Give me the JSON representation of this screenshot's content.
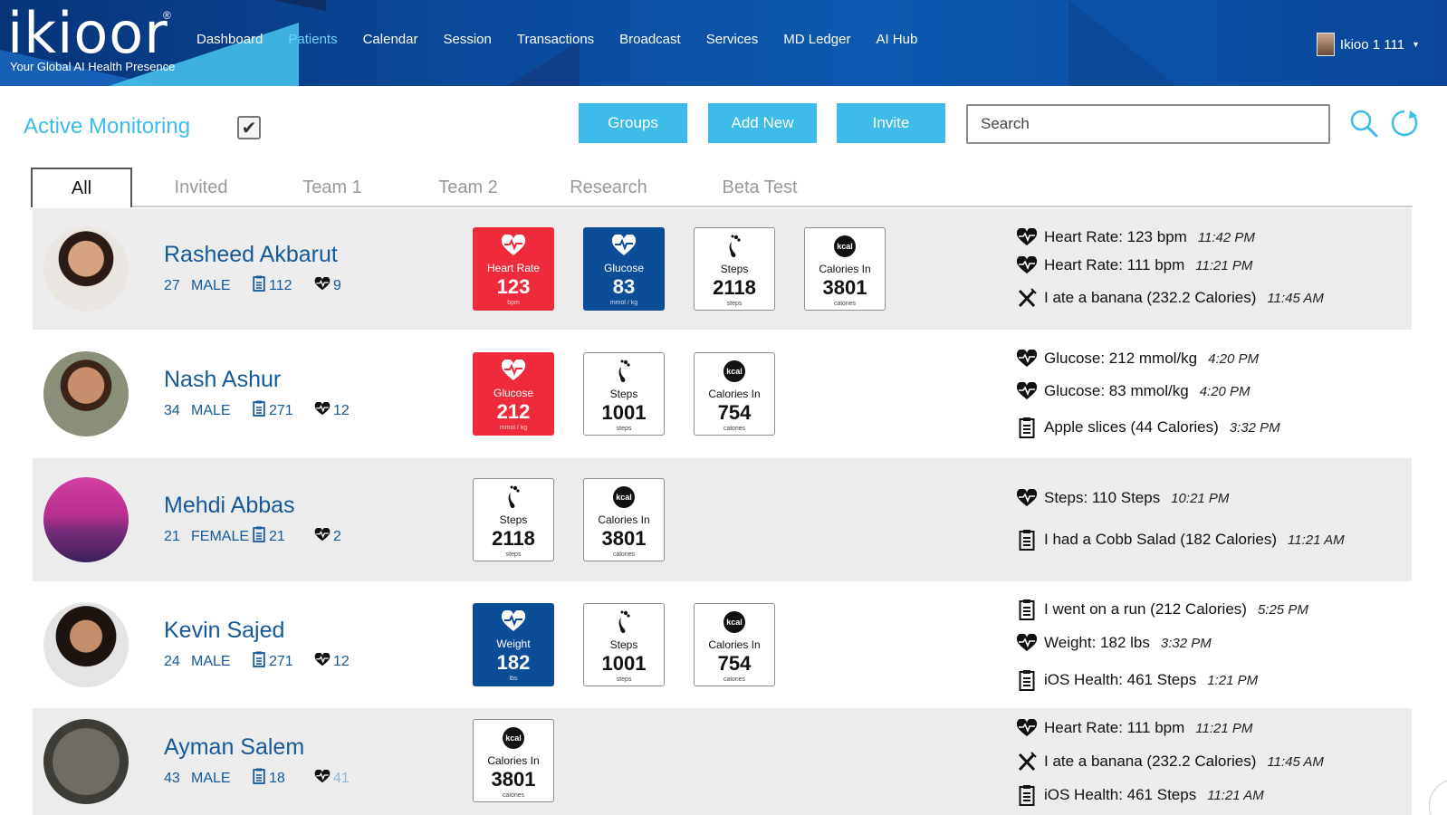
{
  "app": {
    "logo": "ikioor",
    "reg_mark": "®",
    "tagline": "Your Global AI Health Presence",
    "user_name": "Ikioo 1 111"
  },
  "nav": [
    "Dashboard",
    "Patients",
    "Calendar",
    "Session",
    "Transactions",
    "Broadcast",
    "Services",
    "MD Ledger",
    "AI Hub"
  ],
  "toolbar": {
    "title": "Active Monitoring",
    "groups": "Groups",
    "add_new": "Add New",
    "invite": "Invite",
    "search_placeholder": "Search"
  },
  "tabs": [
    "All",
    "Invited",
    "Team 1",
    "Team 2",
    "Research",
    "Beta Test"
  ],
  "colors": {
    "accent": "#3dbbe9",
    "navy": "#15599a",
    "red_card": "#ee2b3b",
    "blue_card": "#0c4d97"
  },
  "patients": [
    {
      "name": "Rasheed Akbarut",
      "age": "27",
      "sex": "MALE",
      "logs": "112",
      "hearts": "9",
      "cards": [
        {
          "style": "red",
          "icon": "heart-pulse-icon",
          "label": "Heart Rate",
          "value": "123",
          "unit": "bpm"
        },
        {
          "style": "blue",
          "icon": "heart-pulse-icon",
          "label": "Glucose",
          "value": "83",
          "unit": "mmol / kg"
        },
        {
          "style": "white",
          "icon": "footprint-icon",
          "label": "Steps",
          "value": "2118",
          "unit": "steps"
        },
        {
          "style": "white",
          "icon": "kcal-icon",
          "label": "Calories In",
          "value": "3801",
          "unit": "calories"
        }
      ],
      "activities": [
        {
          "icon": "heart-icon",
          "text": "Heart Rate: 123 bpm",
          "time": "11:42 PM"
        },
        {
          "icon": "heart-icon",
          "text": "Heart Rate: 111 bpm",
          "time": "11:21 PM"
        },
        {
          "icon": "utensils-icon",
          "text": "I ate a banana (232.2 Calories)",
          "time": "11:45 AM"
        }
      ]
    },
    {
      "name": "Nash Ashur",
      "age": "34",
      "sex": "MALE",
      "logs": "271",
      "hearts": "12",
      "cards": [
        {
          "style": "red",
          "icon": "heart-pulse-icon",
          "label": "Glucose",
          "value": "212",
          "unit": "mmol / kg"
        },
        {
          "style": "white",
          "icon": "footprint-icon",
          "label": "Steps",
          "value": "1001",
          "unit": "steps"
        },
        {
          "style": "white",
          "icon": "kcal-icon",
          "label": "Calories In",
          "value": "754",
          "unit": "calories"
        }
      ],
      "activities": [
        {
          "icon": "heart-icon",
          "text": "Glucose: 212 mmol/kg",
          "time": "4:20 PM"
        },
        {
          "icon": "heart-icon",
          "text": "Glucose: 83 mmol/kg",
          "time": "4:20 PM"
        },
        {
          "icon": "clipboard-icon",
          "text": "Apple slices (44 Calories)",
          "time": "3:32 PM"
        }
      ]
    },
    {
      "name": "Mehdi Abbas",
      "age": "21",
      "sex": "FEMALE",
      "logs": "21",
      "hearts": "2",
      "cards": [
        {
          "style": "white",
          "icon": "footprint-icon",
          "label": "Steps",
          "value": "2118",
          "unit": "steps"
        },
        {
          "style": "white",
          "icon": "kcal-icon",
          "label": "Calories In",
          "value": "3801",
          "unit": "calories"
        }
      ],
      "activities": [
        {
          "icon": "heart-icon",
          "text": "Steps: 110 Steps",
          "time": "10:21 PM"
        },
        {
          "icon": "clipboard-icon",
          "text": "I had a Cobb Salad (182 Calories)",
          "time": "11:21 AM"
        }
      ]
    },
    {
      "name": "Kevin Sajed",
      "age": "24",
      "sex": "MALE",
      "logs": "271",
      "hearts": "12",
      "cards": [
        {
          "style": "blue",
          "icon": "heart-pulse-icon",
          "label": "Weight",
          "value": "182",
          "unit": "lbs"
        },
        {
          "style": "white",
          "icon": "footprint-icon",
          "label": "Steps",
          "value": "1001",
          "unit": "steps"
        },
        {
          "style": "white",
          "icon": "kcal-icon",
          "label": "Calories In",
          "value": "754",
          "unit": "calories"
        }
      ],
      "activities": [
        {
          "icon": "clipboard-icon",
          "text": "I went on a run (212 Calories)",
          "time": "5:25 PM"
        },
        {
          "icon": "heart-icon",
          "text": "Weight: 182 lbs",
          "time": "3:32 PM"
        },
        {
          "icon": "clipboard-icon",
          "text": "iOS Health: 461 Steps",
          "time": "1:21 PM"
        }
      ]
    },
    {
      "name": "Ayman Salem",
      "age": "43",
      "sex": "MALE",
      "logs": "18",
      "hearts": "41",
      "cards": [
        {
          "style": "white",
          "icon": "kcal-icon",
          "label": "Calories In",
          "value": "3801",
          "unit": "calories"
        }
      ],
      "activities": [
        {
          "icon": "heart-icon",
          "text": "Heart Rate: 111 bpm",
          "time": "11:21 PM"
        },
        {
          "icon": "utensils-icon",
          "text": "I ate a banana (232.2 Calories)",
          "time": "11:45 AM"
        },
        {
          "icon": "clipboard-icon",
          "text": "iOS Health: 461 Steps",
          "time": "11:21 AM"
        }
      ]
    }
  ]
}
